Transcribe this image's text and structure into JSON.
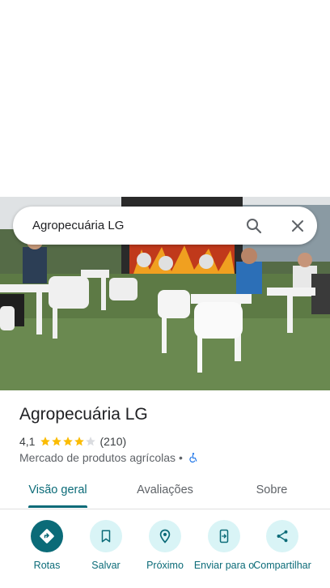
{
  "search": {
    "query": "Agropecuária LG"
  },
  "place": {
    "name": "Agropecuária LG",
    "rating": "4,1",
    "rating_value": 4.1,
    "rating_max": 5,
    "review_count": "(210)",
    "category": "Mercado de produtos agrícolas",
    "separator": "•",
    "accessibility_icon": "wheelchair-icon"
  },
  "tabs": [
    {
      "label": "Visão geral",
      "active": true
    },
    {
      "label": "Avaliações",
      "active": false
    },
    {
      "label": "Sobre",
      "active": false
    }
  ],
  "actions": [
    {
      "label": "Rotas",
      "icon": "directions-icon"
    },
    {
      "label": "Salvar",
      "icon": "bookmark-icon"
    },
    {
      "label": "Próximo",
      "icon": "nearby-icon"
    },
    {
      "label": "Enviar para o",
      "icon": "send-to-phone-icon"
    },
    {
      "label": "Compartilhar",
      "icon": "share-icon"
    }
  ],
  "colors": {
    "accent": "#0b6b78",
    "accent_light": "#d9f4f6",
    "star": "#fbbc04",
    "star_empty": "#dadce0"
  }
}
